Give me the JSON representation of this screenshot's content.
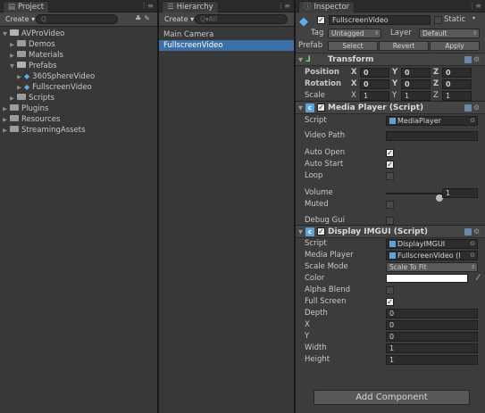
{
  "project": {
    "tab_label": "Project",
    "tab_glyph": "▤",
    "create_label": "Create ▾",
    "search_placeholder": "Q",
    "tree": [
      {
        "label": "AVProVideo",
        "depth": 0,
        "expanded": true,
        "kind": "folder"
      },
      {
        "label": "Demos",
        "depth": 1,
        "expanded": false,
        "kind": "folder"
      },
      {
        "label": "Materials",
        "depth": 1,
        "expanded": false,
        "kind": "folder"
      },
      {
        "label": "Prefabs",
        "depth": 1,
        "expanded": true,
        "kind": "folder"
      },
      {
        "label": "360SphereVideo",
        "depth": 2,
        "expanded": false,
        "kind": "prefab"
      },
      {
        "label": "FullscreenVideo",
        "depth": 2,
        "expanded": false,
        "kind": "prefab"
      },
      {
        "label": "Scripts",
        "depth": 1,
        "expanded": false,
        "kind": "folder"
      },
      {
        "label": "Plugins",
        "depth": 0,
        "expanded": false,
        "kind": "folder"
      },
      {
        "label": "Resources",
        "depth": 0,
        "expanded": false,
        "kind": "folder"
      },
      {
        "label": "StreamingAssets",
        "depth": 0,
        "expanded": false,
        "kind": "folder"
      }
    ]
  },
  "hierarchy": {
    "tab_label": "Hierarchy",
    "tab_glyph": "☰",
    "create_label": "Create ▾",
    "search_placeholder": "Q▾All",
    "items": [
      {
        "label": "Main Camera",
        "selected": false
      },
      {
        "label": "FullscreenVideo",
        "selected": true
      }
    ]
  },
  "inspector": {
    "tab_label": "Inspector",
    "tab_glyph": "ⓘ",
    "object_name": "FullscreenVideo",
    "static_label": "Static",
    "tag_label": "Tag",
    "tag_value": "Untagged",
    "layer_label": "Layer",
    "layer_value": "Default",
    "prefab_label": "Prefab",
    "prefab_buttons": [
      "Select",
      "Revert",
      "Apply"
    ],
    "transform": {
      "title": "Transform",
      "rows": [
        {
          "label": "Position",
          "x": "0",
          "y": "0",
          "z": "0",
          "bold": true
        },
        {
          "label": "Rotation",
          "x": "0",
          "y": "0",
          "z": "0",
          "bold": true
        },
        {
          "label": "Scale",
          "x": "1",
          "y": "1",
          "z": "1",
          "bold": false
        }
      ],
      "axis_labels": [
        "X",
        "Y",
        "Z"
      ]
    },
    "media_player": {
      "title": "Media Player (Script)",
      "script_label": "Script",
      "script_value": "MediaPlayer",
      "video_path_label": "Video Path",
      "video_path_value": "",
      "auto_open_label": "Auto Open",
      "auto_open": true,
      "auto_start_label": "Auto Start",
      "auto_start": true,
      "loop_label": "Loop",
      "loop": false,
      "volume_label": "Volume",
      "volume_value": "1",
      "volume_fraction": 1.0,
      "muted_label": "Muted",
      "muted": false,
      "debug_gui_label": "Debug Gui",
      "debug_gui": false
    },
    "display_imgui": {
      "title": "Display IMGUI (Script)",
      "script_label": "Script",
      "script_value": "DisplayIMGUI",
      "media_player_label": "Media Player",
      "media_player_value": "FullscreenVideo (I",
      "scale_mode_label": "Scale Mode",
      "scale_mode_value": "Scale To Fit",
      "color_label": "Color",
      "color_value": "#ffffff",
      "alpha_blend_label": "Alpha Blend",
      "alpha_blend": false,
      "full_screen_label": "Full Screen",
      "full_screen": true,
      "depth_label": "Depth",
      "depth_value": "0",
      "x_label": "X",
      "x_value": "0",
      "y_label": "Y",
      "y_value": "0",
      "width_label": "Width",
      "width_value": "1",
      "height_label": "Height",
      "height_value": "1"
    },
    "add_component_label": "Add Component"
  },
  "colors": {
    "selection": "#3d6fa8",
    "panel_bg": "#383838",
    "accent_icon": "#5fb0ea"
  }
}
